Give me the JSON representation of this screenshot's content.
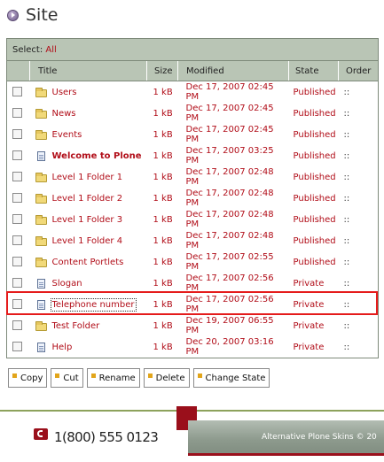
{
  "header": {
    "title": "Site",
    "icon": "site-bullet-icon"
  },
  "listing": {
    "select_label": "Select:",
    "select_all": "All",
    "columns": {
      "title": "Title",
      "size": "Size",
      "modified": "Modified",
      "state": "State",
      "order": "Order"
    },
    "rows": [
      {
        "type": "folder",
        "title": "Users",
        "size": "1 kB",
        "modified": "Dec 17, 2007 02:45 PM",
        "state": "Published",
        "order": "::"
      },
      {
        "type": "folder",
        "title": "News",
        "size": "1 kB",
        "modified": "Dec 17, 2007 02:45 PM",
        "state": "Published",
        "order": "::"
      },
      {
        "type": "folder",
        "title": "Events",
        "size": "1 kB",
        "modified": "Dec 17, 2007 02:45 PM",
        "state": "Published",
        "order": "::"
      },
      {
        "type": "document",
        "title": "Welcome to Plone",
        "size": "1 kB",
        "modified": "Dec 17, 2007 03:25 PM",
        "state": "Published",
        "order": "::"
      },
      {
        "type": "folder",
        "title": "Level 1 Folder 1",
        "size": "1 kB",
        "modified": "Dec 17, 2007 02:48 PM",
        "state": "Published",
        "order": "::"
      },
      {
        "type": "folder",
        "title": "Level 1 Folder 2",
        "size": "1 kB",
        "modified": "Dec 17, 2007 02:48 PM",
        "state": "Published",
        "order": "::"
      },
      {
        "type": "folder",
        "title": "Level 1 Folder 3",
        "size": "1 kB",
        "modified": "Dec 17, 2007 02:48 PM",
        "state": "Published",
        "order": "::"
      },
      {
        "type": "folder",
        "title": "Level 1 Folder 4",
        "size": "1 kB",
        "modified": "Dec 17, 2007 02:48 PM",
        "state": "Published",
        "order": "::"
      },
      {
        "type": "folder",
        "title": "Content Portlets",
        "size": "1 kB",
        "modified": "Dec 17, 2007 02:55 PM",
        "state": "Published",
        "order": "::"
      },
      {
        "type": "document",
        "title": "Slogan",
        "size": "1 kB",
        "modified": "Dec 17, 2007 02:56 PM",
        "state": "Private",
        "order": "::"
      },
      {
        "type": "document",
        "title": "Telephone number",
        "size": "1 kB",
        "modified": "Dec 17, 2007 02:56 PM",
        "state": "Private",
        "order": "::"
      },
      {
        "type": "folder",
        "title": "Test Folder",
        "size": "1 kB",
        "modified": "Dec 19, 2007 06:55 PM",
        "state": "Private",
        "order": "::"
      },
      {
        "type": "document",
        "title": "Help",
        "size": "1 kB",
        "modified": "Dec 20, 2007 03:16 PM",
        "state": "Private",
        "order": "::"
      }
    ]
  },
  "actions": {
    "copy": "Copy",
    "cut": "Cut",
    "rename": "Rename",
    "delete": "Delete",
    "change_state": "Change State"
  },
  "footer": {
    "phone": "1(800) 555 0123",
    "skin_text": "Alternative Plone Skins © 20"
  },
  "colors": {
    "link_red": "#b10d18",
    "table_header": "#b9c5b5",
    "accent_green": "#8da25c",
    "brand_red": "#9a0f1b",
    "highlight": "#e51b1b"
  }
}
